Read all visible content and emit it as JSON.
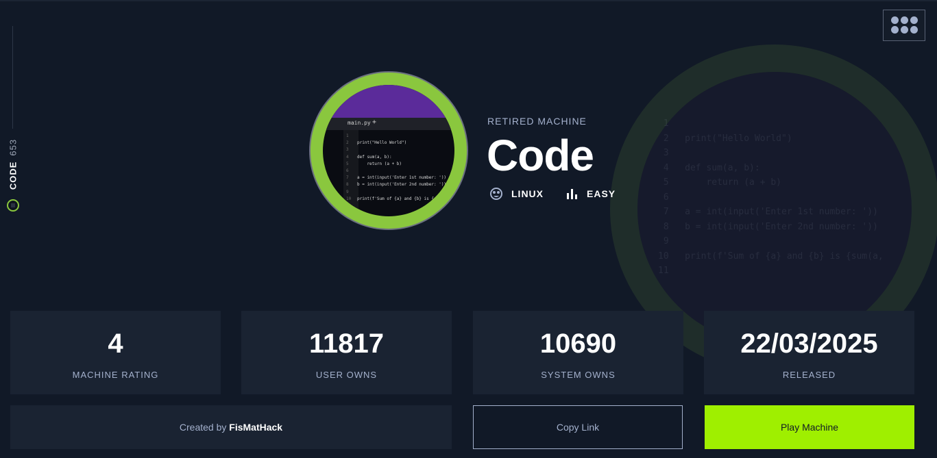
{
  "sidebar": {
    "machine_name": "CODE",
    "machine_id": "653"
  },
  "header": {
    "menu_icon": "grid-menu-icon"
  },
  "machine": {
    "status": "RETIRED MACHINE",
    "name": "Code",
    "os": "LINUX",
    "os_icon": "linux-penguin-icon",
    "difficulty": "EASY",
    "difficulty_icon": "difficulty-bars-icon",
    "avatar": {
      "tab_name": "main.py",
      "tab_plus": "+",
      "code_lines": [
        {
          "n": "1",
          "t": ""
        },
        {
          "n": "2",
          "t": "print(\"Hello World\")"
        },
        {
          "n": "3",
          "t": ""
        },
        {
          "n": "4",
          "t": "def sum(a, b):"
        },
        {
          "n": "5",
          "t": "    return (a + b)"
        },
        {
          "n": "6",
          "t": ""
        },
        {
          "n": "7",
          "t": "a = int(input('Enter 1st number: '))"
        },
        {
          "n": "8",
          "t": "b = int(input('Enter 2nd number: '))"
        },
        {
          "n": "9",
          "t": ""
        },
        {
          "n": "10",
          "t": "print(f'Sum of {a} and {b} is {sum(a,"
        },
        {
          "n": "11",
          "t": ""
        }
      ]
    }
  },
  "stats": [
    {
      "value": "4",
      "label": "MACHINE RATING"
    },
    {
      "value": "11817",
      "label": "USER OWNS"
    },
    {
      "value": "10690",
      "label": "SYSTEM OWNS"
    },
    {
      "value": "22/03/2025",
      "label": "RELEASED"
    }
  ],
  "footer": {
    "created_prefix": "Created by",
    "creator": "FisMatHack",
    "copy_link": "Copy Link",
    "play": "Play Machine"
  },
  "colors": {
    "accent": "#9fef00",
    "ring": "#8ac73e",
    "background": "#111927",
    "card": "#1a2332",
    "muted": "#a4b1cd"
  }
}
